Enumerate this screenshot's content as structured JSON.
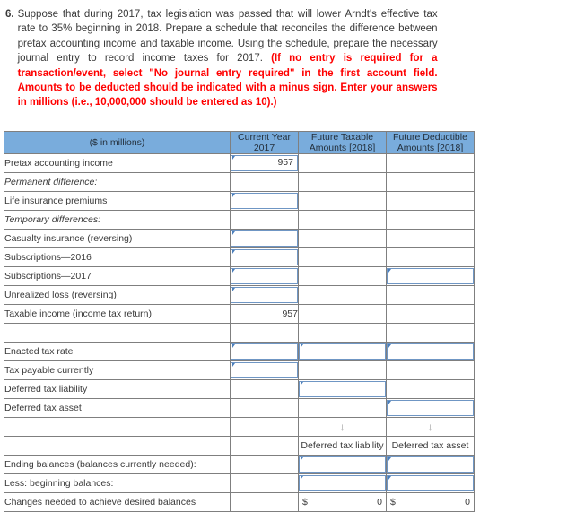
{
  "question": {
    "number": "6.",
    "text_plain": "Suppose that during 2017, tax legislation was passed that will lower Arndt's effective tax rate to 35% beginning in 2018. Prepare a schedule that reconciles the difference between pretax accounting income and taxable income. Using the schedule, prepare the necessary journal entry to record income taxes for 2017.",
    "text_emphasis": "(If no entry is required for a transaction/event, select \"No journal entry required\" in the first account field. Amounts to be deducted should be indicated with a minus sign. Enter your answers in millions (i.e., 10,000,000 should be entered as 10).)"
  },
  "table": {
    "headers": [
      "($ in millions)",
      "Current Year 2017",
      "Future Taxable Amounts [2018]",
      "Future Deductible Amounts [2018]"
    ],
    "header_lines": {
      "col0": "($ in millions)",
      "col1_line1": "Current Year",
      "col1_line2": "2017",
      "col2_line1": "Future Taxable",
      "col2_line2": "Amounts [2018]",
      "col3_line1": "Future Deductible",
      "col3_line2": "Amounts [2018]"
    },
    "rows": [
      {
        "label": "Pretax accounting income",
        "current": "957"
      },
      {
        "label": "Permanent difference:"
      },
      {
        "label": "Life insurance premiums"
      },
      {
        "label": "Temporary differences:"
      },
      {
        "label": "Casualty insurance (reversing)"
      },
      {
        "label": "Subscriptions—2016"
      },
      {
        "label": "Subscriptions—2017"
      },
      {
        "label": "Unrealized loss (reversing)"
      },
      {
        "label": "Taxable income (income tax return)",
        "current": "957"
      },
      {
        "label": ""
      },
      {
        "label": "Enacted tax rate"
      },
      {
        "label": "Tax payable currently"
      },
      {
        "label": "Deferred tax liability"
      },
      {
        "label": "Deferred tax asset"
      },
      {
        "label": ""
      },
      {
        "label": ""
      },
      {
        "label": "Ending balances (balances currently needed):"
      },
      {
        "label": "Less: beginning balances:"
      },
      {
        "label": "Changes needed to achieve desired balances"
      }
    ],
    "arrow_glyph": "↓",
    "footer_col_labels": {
      "taxable": "Deferred tax liability",
      "deductible": "Deferred tax asset"
    },
    "totals": {
      "taxable_currency": "$",
      "taxable_value": "0",
      "deductible_currency": "$",
      "deductible_value": "0"
    }
  },
  "colors": {
    "header_blue": "#79ACDC",
    "emphasis_red": "#ff0000",
    "input_border": "#6f96c4",
    "grid": "#7f7f7f"
  }
}
